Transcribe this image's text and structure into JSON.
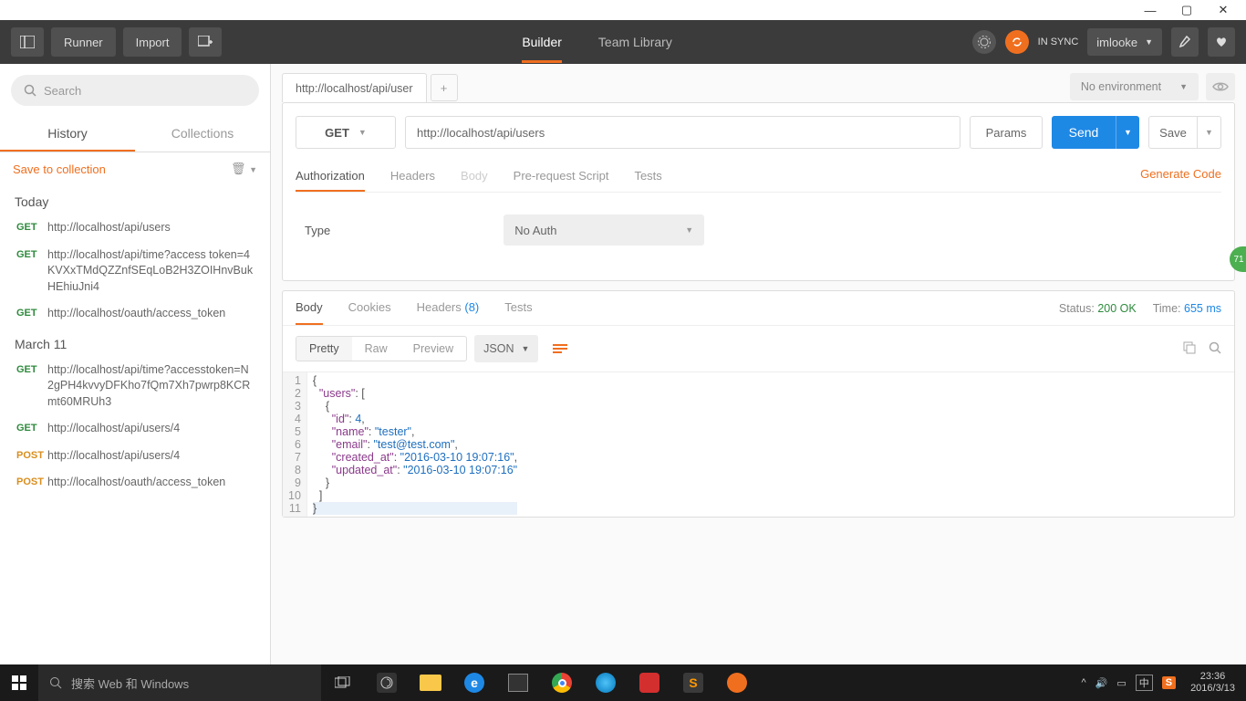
{
  "titlebar": {
    "min": "—",
    "max": "▢",
    "close": "✕"
  },
  "toolbar": {
    "runner": "Runner",
    "import": "Import",
    "builder": "Builder",
    "team": "Team Library",
    "sync": "IN SYNC",
    "user": "imlooke"
  },
  "sidebar": {
    "search_ph": "Search",
    "tab_history": "History",
    "tab_collections": "Collections",
    "save": "Save to collection",
    "groups": [
      {
        "title": "Today",
        "items": [
          {
            "method": "GET",
            "url": "http://localhost/api/users"
          },
          {
            "method": "GET",
            "url": "http://localhost/api/time?access token=4KVXxTMdQZZnfSEqLoB2H3ZOIHnvBukHEhiuJni4"
          },
          {
            "method": "GET",
            "url": "http://localhost/oauth/access_token"
          }
        ]
      },
      {
        "title": "March 11",
        "items": [
          {
            "method": "GET",
            "url": "http://localhost/api/time?accesstoken=N2gPH4kvvyDFKho7fQm7Xh7pwrp8KCRmt60MRUh3"
          },
          {
            "method": "GET",
            "url": "http://localhost/api/users/4"
          },
          {
            "method": "POST",
            "url": "http://localhost/api/users/4"
          },
          {
            "method": "POST",
            "url": "http://localhost/oauth/access_token"
          }
        ]
      }
    ]
  },
  "request": {
    "tab_title": "http://localhost/api/user",
    "env": "No environment",
    "method": "GET",
    "url": "http://localhost/api/users",
    "params": "Params",
    "send": "Send",
    "save": "Save",
    "tabs": {
      "auth": "Authorization",
      "headers": "Headers",
      "body": "Body",
      "pre": "Pre-request Script",
      "tests": "Tests"
    },
    "gen": "Generate Code",
    "type_lbl": "Type",
    "auth_sel": "No Auth"
  },
  "response": {
    "tabs": {
      "body": "Body",
      "cookies": "Cookies",
      "headers": "Headers",
      "hcount": "(8)",
      "tests": "Tests"
    },
    "status_lbl": "Status:",
    "status": "200 OK",
    "time_lbl": "Time:",
    "time": "655 ms",
    "fmt": {
      "pretty": "Pretty",
      "raw": "Raw",
      "preview": "Preview",
      "json": "JSON"
    },
    "lines": [
      "1",
      "2",
      "3",
      "4",
      "5",
      "6",
      "7",
      "8",
      "9",
      "10",
      "11"
    ],
    "json": {
      "users_key": "\"users\"",
      "id_key": "\"id\"",
      "id_val": "4",
      "name_key": "\"name\"",
      "name_val": "\"tester\"",
      "email_key": "\"email\"",
      "email_val": "\"test@test.com\"",
      "created_key": "\"created_at\"",
      "created_val": "\"2016-03-10 19:07:16\"",
      "updated_key": "\"updated_at\"",
      "updated_val": "\"2016-03-10 19:07:16\""
    }
  },
  "taskbar": {
    "search": "搜索 Web 和 Windows",
    "ime": "中",
    "clock_time": "23:36",
    "clock_date": "2016/3/13"
  },
  "badge": "71"
}
